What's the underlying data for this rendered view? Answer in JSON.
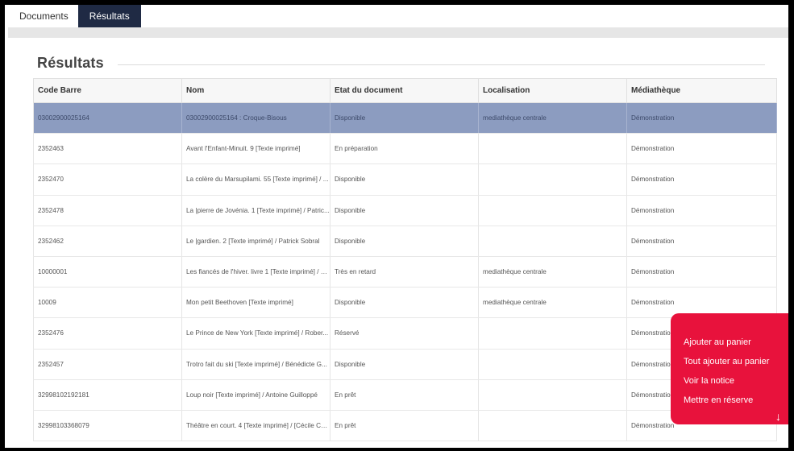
{
  "tabs": [
    {
      "label": "Documents"
    },
    {
      "label": "Résultats"
    }
  ],
  "section": {
    "title": "Résultats"
  },
  "table": {
    "columns": [
      "Code Barre",
      "Nom",
      "Etat du document",
      "Localisation",
      "Médiathèque"
    ],
    "rows": [
      [
        "03002900025164",
        "03002900025164 : Croque-Bisous",
        "Disponible",
        "mediathèque centrale",
        "Démonstration"
      ],
      [
        "2352463",
        "Avant l'Enfant-Minuit. 9 [Texte imprimé]",
        "En préparation",
        "",
        "Démonstration"
      ],
      [
        "2352470",
        "La colère du Marsupilami. 55 [Texte imprimé] / ...",
        "Disponible",
        "",
        "Démonstration"
      ],
      [
        "2352478",
        "La |pierre de Jovénia. 1 [Texte imprimé] / Patric...",
        "Disponible",
        "",
        "Démonstration"
      ],
      [
        "2352462",
        "Le |gardien. 2 [Texte imprimé] / Patrick Sobral",
        "Disponible",
        "",
        "Démonstration"
      ],
      [
        "10000001",
        "Les fiancés de l'hiver. livre 1 [Texte imprimé] / C...",
        "Très en retard",
        "mediathèque centrale",
        "Démonstration"
      ],
      [
        "10009",
        "Mon petit Beethoven [Texte imprimé]",
        "Disponible",
        "mediathèque centrale",
        "Démonstration"
      ],
      [
        "2352476",
        "Le Prince de New York [Texte imprimé] / Rober...",
        "Réservé",
        "",
        "Démonstration"
      ],
      [
        "2352457",
        "Trotro fait du ski [Texte imprimé] / Bénédicte G...",
        "Disponible",
        "",
        "Démonstration"
      ],
      [
        "32998102192181",
        "Loup noir [Texte imprimé] / Antoine Guilloppé",
        "En prêt",
        "",
        "Démonstration"
      ],
      [
        "32998103368079",
        "Théâtre en court. 4 [Texte imprimé] / [Cécile Co...",
        "En prêt",
        "",
        "Démonstration"
      ]
    ]
  },
  "popup": {
    "items": [
      "Ajouter au panier",
      "Tout ajouter au panier",
      "Voir la notice",
      "Mettre en réserve"
    ],
    "arrow_icon": "arrow-down-icon",
    "color": "#e8123c"
  },
  "colors": {
    "tab_active": "#1f2a44",
    "row_selected": "#8c9cc0"
  }
}
